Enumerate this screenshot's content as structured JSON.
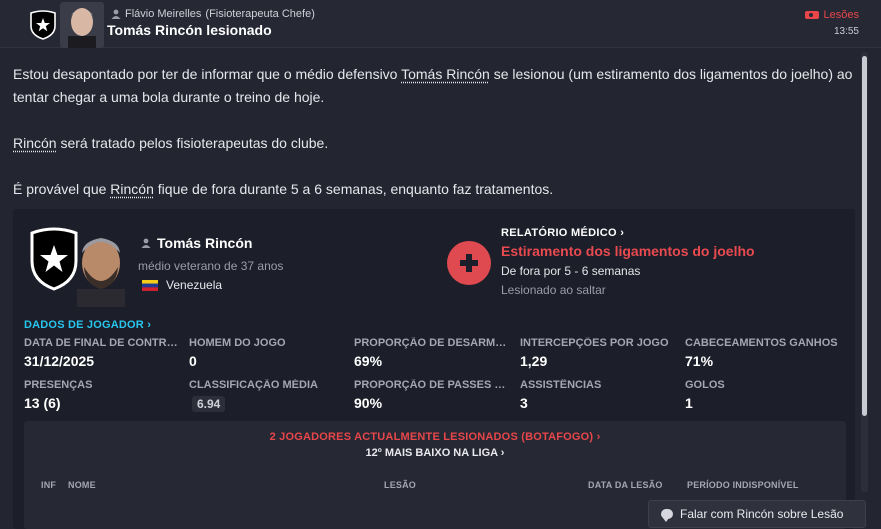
{
  "header": {
    "sender_name": "Flávio Meirelles",
    "sender_role": "(Fisioterapeuta Chefe)",
    "subject": "Tomás Rincón lesionado",
    "tag": "Lesões",
    "time": "13:55"
  },
  "message": {
    "p1_a": "Estou desapontado por ter de informar que o médio defensivo ",
    "p1_link": "Tomás Rincón",
    "p1_b": " se lesionou (um estiramento dos ligamentos do joelho) ao tentar chegar a uma bola durante o treino de hoje.",
    "p2_link": "Rincón",
    "p2_b": " será tratado pelos fisioterapeutas do clube.",
    "p3_a": "É provável que ",
    "p3_link": "Rincón",
    "p3_b": " fique de fora durante 5 a 6 semanas, enquanto faz tratamentos."
  },
  "player": {
    "name": "Tomás Rincón",
    "description": "médio veterano de 37 anos",
    "nationality": "Venezuela"
  },
  "medical": {
    "title": "RELATÓRIO MÉDICO",
    "injury": "Estiramento dos ligamentos do joelho",
    "duration": "De fora por 5 - 6 semanas",
    "cause": "Lesionado ao saltar"
  },
  "player_data": {
    "link": "DADOS DE JOGADOR",
    "stats": [
      {
        "label": "DATA DE FINAL DE CONTRA...",
        "value": "31/12/2025"
      },
      {
        "label": "HOMEM DO JOGO",
        "value": "0"
      },
      {
        "label": "PROPORÇÃO DE DESARMES...",
        "value": "69%"
      },
      {
        "label": "INTERCEPÇÕES POR JOGO",
        "value": "1,29"
      },
      {
        "label": "CABECEAMENTOS GANHOS",
        "value": "71%"
      },
      {
        "label": "PRESENÇAS",
        "value": "13 (6)"
      },
      {
        "label": "CLASSIFICAÇÃO MÉDIA",
        "value": "6.94"
      },
      {
        "label": "PROPORÇÃO DE PASSES CE...",
        "value": "90%"
      },
      {
        "label": "ASSISTÊNCIAS",
        "value": "3"
      },
      {
        "label": "GOLOS",
        "value": "1"
      }
    ]
  },
  "injuries": {
    "link": "2 JOGADORES ACTUALMENTE LESIONADOS (BOTAFOGO)",
    "rank": "12º MAIS BAIXO NA LIGA",
    "columns": [
      "INF",
      "NOME",
      "LESÃO",
      "DATA DA LESÃO",
      "PERÍODO INDISPONÍVEL"
    ]
  },
  "actions": {
    "talk": "Falar com Rincón sobre Lesão"
  },
  "colors": {
    "accent_red": "#e8464a",
    "link_cyan": "#28c6ee",
    "background": "#232530"
  }
}
